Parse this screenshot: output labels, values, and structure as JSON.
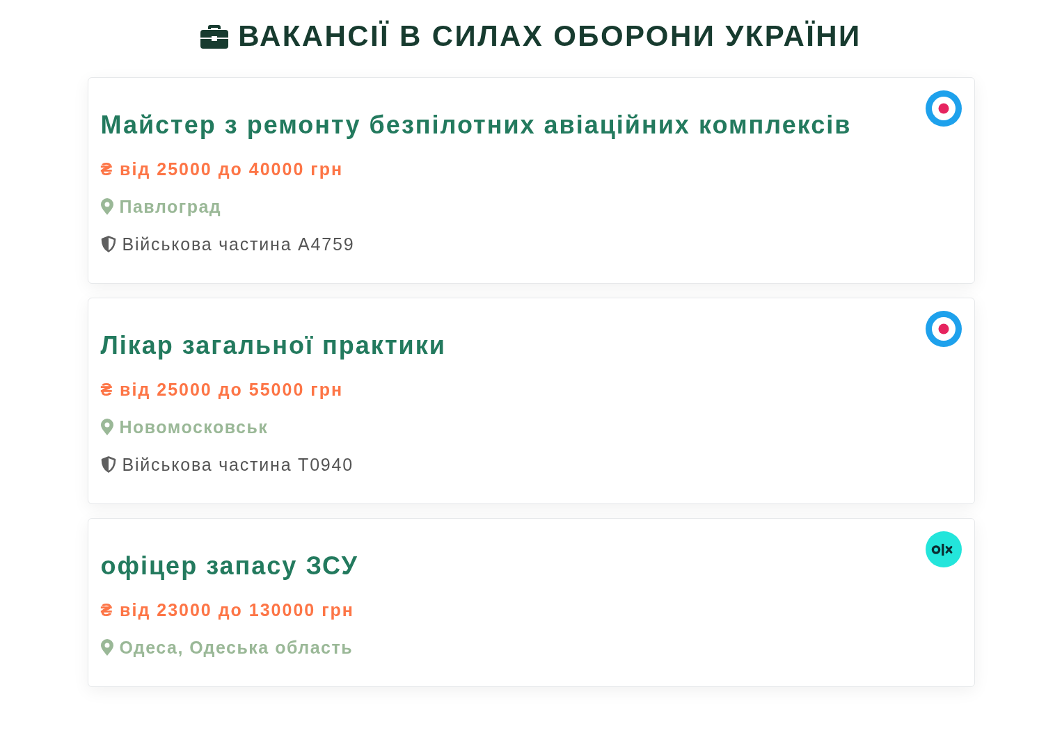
{
  "page_title": "ВАКАНСІЇ В СИЛАХ ОБОРОНИ УКРАЇНИ",
  "vacancies": [
    {
      "kind": "roundel",
      "title": "Майстер з ремонту безпілотних авіаційних комплексів",
      "salary": "₴ від 25000 до 40000 грн",
      "location": "Павлоград",
      "employer": "Військова частина А4759"
    },
    {
      "kind": "roundel",
      "title": "Лікар загальної практики",
      "salary": "₴ від 25000 до 55000 грн",
      "location": "Новомосковськ",
      "employer": "Військова частина Т0940"
    },
    {
      "kind": "monogram",
      "title": "офіцер запасу ЗСУ",
      "salary": "₴ від 23000 до 130000 грн",
      "location": "Одеса, Одеська область"
    }
  ]
}
